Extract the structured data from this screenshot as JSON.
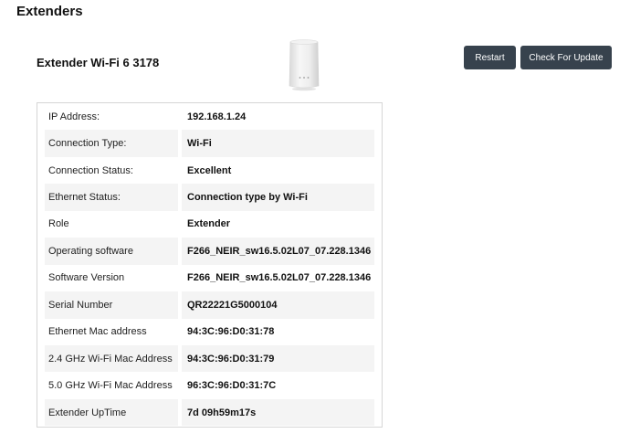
{
  "page": {
    "title": "Extenders"
  },
  "device": {
    "name": "Extender Wi-Fi 6 3178",
    "image_icon": "wifi-extender-device-icon"
  },
  "actions": {
    "restart_label": "Restart",
    "update_label": "Check For Update"
  },
  "colors": {
    "button_bg": "#37424d",
    "row_shade": "#f4f4f4",
    "border": "#d6d6d6"
  },
  "details": [
    {
      "label": "IP Address:",
      "value": "192.168.1.24"
    },
    {
      "label": "Connection Type:",
      "value": "Wi-Fi"
    },
    {
      "label": "Connection Status:",
      "value": "Excellent"
    },
    {
      "label": "Ethernet Status:",
      "value": "Connection type by Wi-Fi"
    },
    {
      "label": "Role",
      "value": "Extender"
    },
    {
      "label": "Operating software",
      "value": "F266_NEIR_sw16.5.02L07_07.228.1346"
    },
    {
      "label": "Software Version",
      "value": "F266_NEIR_sw16.5.02L07_07.228.1346"
    },
    {
      "label": "Serial Number",
      "value": "QR22221G5000104"
    },
    {
      "label": "Ethernet Mac address",
      "value": "94:3C:96:D0:31:78"
    },
    {
      "label": "2.4 GHz Wi-Fi Mac Address",
      "value": "94:3C:96:D0:31:79"
    },
    {
      "label": "5.0 GHz Wi-Fi Mac Address",
      "value": "96:3C:96:D0:31:7C"
    },
    {
      "label": "Extender UpTime",
      "value": "7d 09h59m17s"
    }
  ]
}
